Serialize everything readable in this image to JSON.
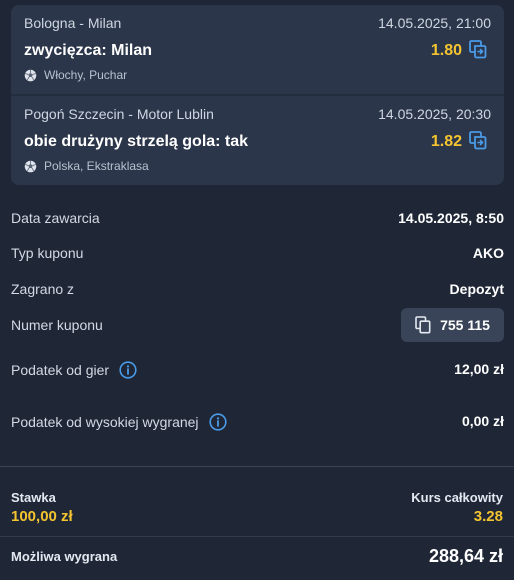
{
  "bets": [
    {
      "match": "Bologna - Milan",
      "datetime": "14.05.2025, 21:00",
      "pick": "zwycięzca: Milan",
      "odds": "1.80",
      "league": "Włochy, Puchar",
      "sport_icon": "soccer-ball-icon",
      "action_icon": "swap-icon"
    },
    {
      "match": "Pogoń Szczecin - Motor Lublin",
      "datetime": "14.05.2025, 20:30",
      "pick": "obie drużyny strzelą gola: tak",
      "odds": "1.82",
      "league": "Polska, Ekstraklasa",
      "sport_icon": "soccer-ball-icon",
      "action_icon": "swap-icon"
    }
  ],
  "details": {
    "date_label": "Data zawarcia",
    "date_value": "14.05.2025, 8:50",
    "type_label": "Typ kuponu",
    "type_value": "AKO",
    "played_label": "Zagrano z",
    "played_value": "Depozyt",
    "coupon_label": "Numer kuponu",
    "coupon_value": "755 115",
    "tax_games_label": "Podatek od gier",
    "tax_games_value": "12,00 zł",
    "tax_high_label": "Podatek od wysokiej wygranej",
    "tax_high_value": "0,00 zł"
  },
  "summary": {
    "stake_label": "Stawka",
    "stake_value": "100,00 zł",
    "total_odds_label": "Kurs całkowity",
    "total_odds_value": "3.28",
    "possible_win_label": "Możliwa wygrana",
    "possible_win_value": "288,64 zł"
  },
  "colors": {
    "background": "#1f2737",
    "card": "#2c364a",
    "accent_yellow": "#f4c430",
    "accent_blue": "#4a9be8"
  }
}
